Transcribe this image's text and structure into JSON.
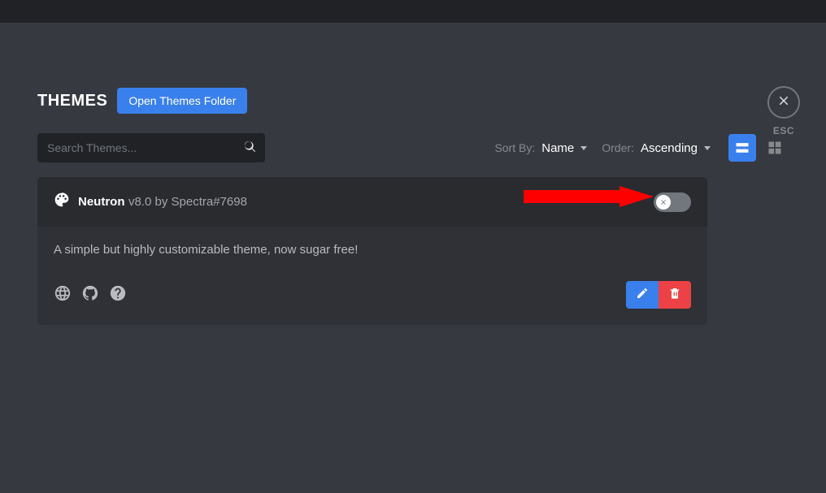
{
  "title": "THEMES",
  "open_folder_label": "Open Themes Folder",
  "search": {
    "placeholder": "Search Themes..."
  },
  "sort": {
    "by_label": "Sort By:",
    "by_value": "Name",
    "order_label": "Order:",
    "order_value": "Ascending"
  },
  "close": {
    "escape_label": "ESC"
  },
  "theme": {
    "name": "Neutron",
    "version": "v8.0",
    "author_prefix": "by",
    "author": "Spectra#7698",
    "description": "A simple but highly customizable theme, now sugar free!",
    "enabled": false
  }
}
